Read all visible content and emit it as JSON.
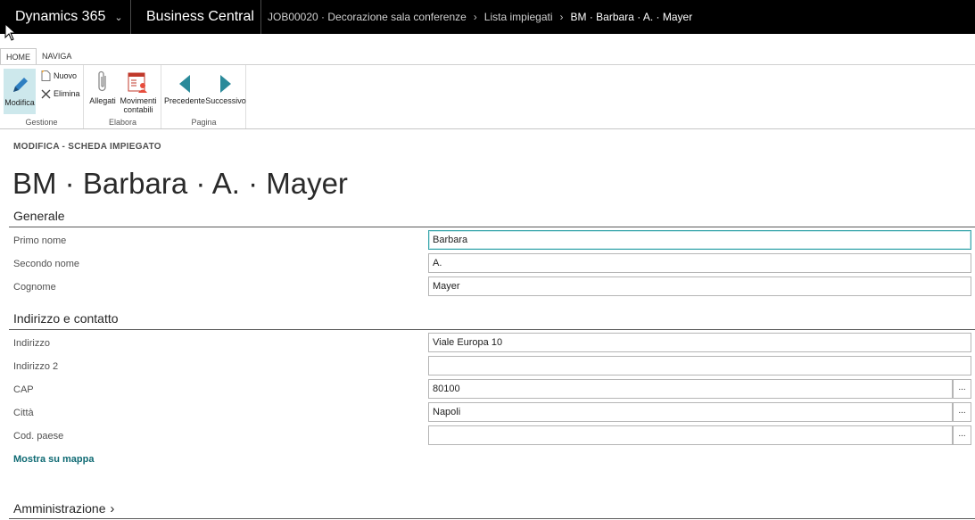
{
  "topbar": {
    "product": "Dynamics 365",
    "app": "Business Central",
    "breadcrumbs": [
      "JOB00020 · Decorazione sala conferenze",
      "Lista impiegati",
      "BM · Barbara · A. · Mayer"
    ]
  },
  "ribbon": {
    "tabs": [
      "HOME",
      "NAVIGA"
    ],
    "groups": {
      "gestione": {
        "label": "Gestione",
        "modifica": "Modifica",
        "nuovo": "Nuovo",
        "elimina": "Elimina"
      },
      "elabora": {
        "label": "Elabora",
        "allegati": "Allegati",
        "movimenti": "Movimenti contabili"
      },
      "pagina": {
        "label": "Pagina",
        "precedente": "Precedente",
        "successivo": "Successivo"
      }
    }
  },
  "page": {
    "subheading": "MODIFICA - SCHEDA IMPIEGATO",
    "title": "BM · Barbara · A. · Mayer"
  },
  "generale": {
    "title": "Generale",
    "primo_nome_label": "Primo nome",
    "primo_nome": "Barbara",
    "secondo_nome_label": "Secondo nome",
    "secondo_nome": "A.",
    "cognome_label": "Cognome",
    "cognome": "Mayer"
  },
  "indirizzo": {
    "title": "Indirizzo e contatto",
    "indirizzo_label": "Indirizzo",
    "indirizzo": "Viale Europa 10",
    "indirizzo2_label": "Indirizzo 2",
    "indirizzo2": "",
    "cap_label": "CAP",
    "cap": "80100",
    "citta_label": "Città",
    "citta": "Napoli",
    "paese_label": "Cod. paese",
    "paese": "",
    "lookup": "...",
    "map_link": "Mostra su mappa"
  },
  "amministrazione": {
    "title": "Amministrazione"
  },
  "colors": {
    "topbar": "#000000",
    "accent": "#0e6a73",
    "ribbon_active": "#cde8ec",
    "focus": "#3aa6ac"
  }
}
